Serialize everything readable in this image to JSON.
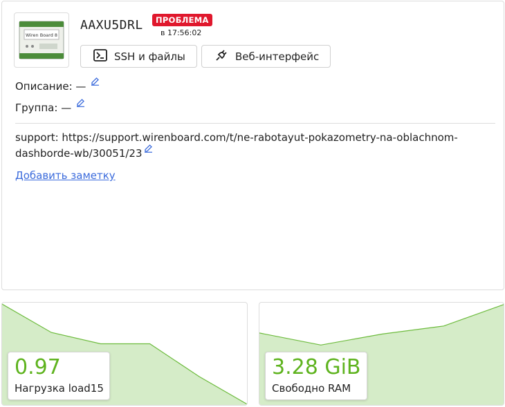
{
  "device": {
    "title": "AAXU5DRL",
    "status_badge": "ПРОБЛЕМА",
    "status_time": "в 17:56:02",
    "thumbnail_label": "Wiren Board 8"
  },
  "actions": {
    "ssh_label": "SSH и файлы",
    "web_label": "Веб-интерфейс"
  },
  "fields": {
    "description_label": "Описание:",
    "description_value": "—",
    "group_label": "Группа:",
    "group_value": "—"
  },
  "note": {
    "text": "support: https://support.wirenboard.com/t/ne-rabotayut-pokazometry-na-oblachnom-dashborde-wb/30051/23",
    "add_label": "Добавить заметку"
  },
  "metrics": [
    {
      "value": "0.97",
      "label": "Нагрузка load15",
      "series": [
        1.6,
        1.15,
        0.97,
        0.97,
        0.45,
        0.0
      ]
    },
    {
      "value": "3.28 GiB",
      "label": "Свободно RAM",
      "series": [
        3.6,
        3.0,
        3.55,
        3.95,
        5.05
      ]
    }
  ],
  "colors": {
    "accent_green": "#5eb31e",
    "badge_red": "#e0182d",
    "link_blue": "#3b6bdc",
    "spark_fill": "#d5ecc8",
    "spark_line": "#6cbb3c"
  }
}
